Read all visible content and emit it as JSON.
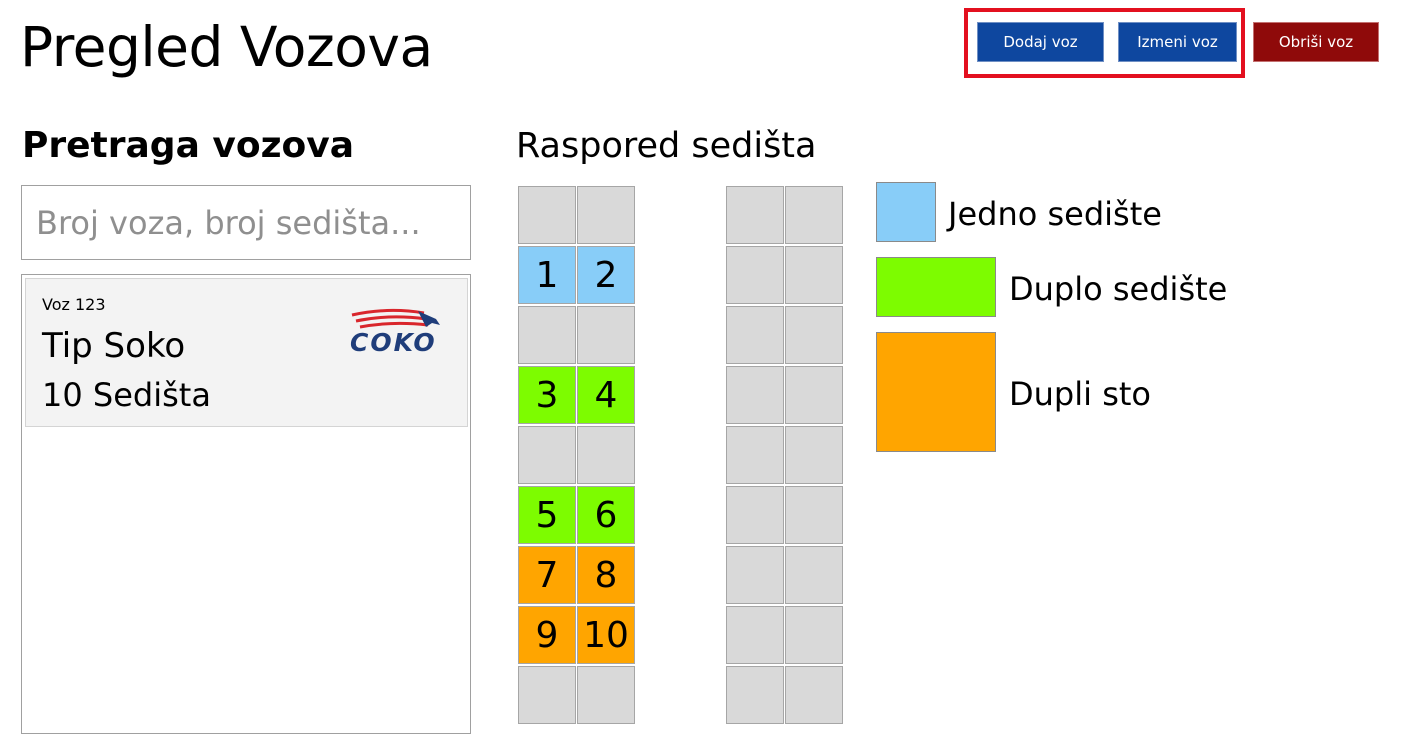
{
  "page": {
    "title": "Pregled Vozova"
  },
  "toolbar": {
    "add_label": "Dodaj voz",
    "edit_label": "Izmeni voz",
    "delete_label": "Obriši voz"
  },
  "search": {
    "heading": "Pretraga vozova",
    "placeholder": "Broj voza, broj sedišta...",
    "value": ""
  },
  "trains": [
    {
      "number": "Voz 123",
      "type": "Tip Soko",
      "seats": "10 Sedišta",
      "logo_text": "COKO"
    }
  ],
  "layout": {
    "heading": "Raspored sedišta",
    "colors": {
      "empty": "#d9d9d9",
      "single": "#88cdf8",
      "double": "#7dfc00",
      "table": "#ffa500"
    },
    "columns": [
      {
        "rows": [
          [
            "empty",
            ""
          ],
          [
            "single",
            "1"
          ],
          [
            "empty",
            ""
          ],
          [
            "double",
            "3"
          ],
          [
            "empty",
            ""
          ],
          [
            "double",
            "5"
          ],
          [
            "table",
            "7"
          ],
          [
            "table",
            "9"
          ],
          [
            "empty",
            ""
          ]
        ]
      },
      {
        "rows": [
          [
            "empty",
            ""
          ],
          [
            "single",
            "2"
          ],
          [
            "empty",
            ""
          ],
          [
            "double",
            "4"
          ],
          [
            "empty",
            ""
          ],
          [
            "double",
            "6"
          ],
          [
            "table",
            "8"
          ],
          [
            "table",
            "10"
          ],
          [
            "empty",
            ""
          ]
        ]
      },
      {
        "rows": [
          [
            "empty",
            ""
          ],
          [
            "empty",
            ""
          ],
          [
            "empty",
            ""
          ],
          [
            "empty",
            ""
          ],
          [
            "empty",
            ""
          ],
          [
            "empty",
            ""
          ],
          [
            "empty",
            ""
          ],
          [
            "empty",
            ""
          ],
          [
            "empty",
            ""
          ]
        ]
      },
      {
        "rows": [
          [
            "empty",
            ""
          ],
          [
            "empty",
            ""
          ],
          [
            "empty",
            ""
          ],
          [
            "empty",
            ""
          ],
          [
            "empty",
            ""
          ],
          [
            "empty",
            ""
          ],
          [
            "empty",
            ""
          ],
          [
            "empty",
            ""
          ],
          [
            "empty",
            ""
          ]
        ]
      }
    ]
  },
  "legend": [
    {
      "kind": "single",
      "label": "Jedno sedište"
    },
    {
      "kind": "double",
      "label": "Duplo sedište"
    },
    {
      "kind": "table",
      "label": "Dupli sto"
    }
  ]
}
